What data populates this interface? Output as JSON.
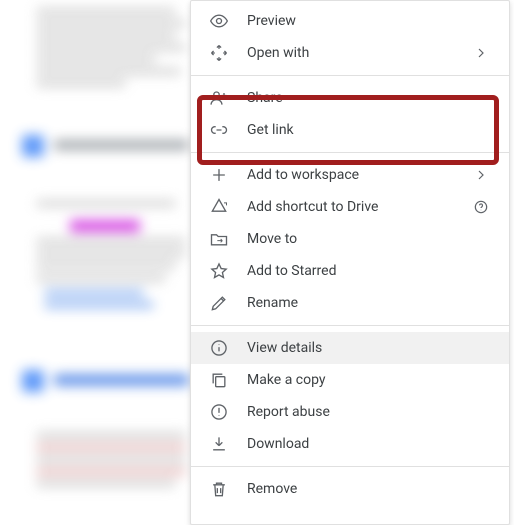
{
  "menu": {
    "preview": {
      "label": "Preview"
    },
    "open_with": {
      "label": "Open with"
    },
    "share": {
      "label": "Share"
    },
    "get_link": {
      "label": "Get link"
    },
    "add_ws": {
      "label": "Add to workspace"
    },
    "shortcut": {
      "label": "Add shortcut to Drive"
    },
    "move": {
      "label": "Move to"
    },
    "star": {
      "label": "Add to Starred"
    },
    "rename": {
      "label": "Rename"
    },
    "details": {
      "label": "View details"
    },
    "copy": {
      "label": "Make a copy"
    },
    "report": {
      "label": "Report abuse"
    },
    "download": {
      "label": "Download"
    },
    "remove": {
      "label": "Remove"
    }
  }
}
